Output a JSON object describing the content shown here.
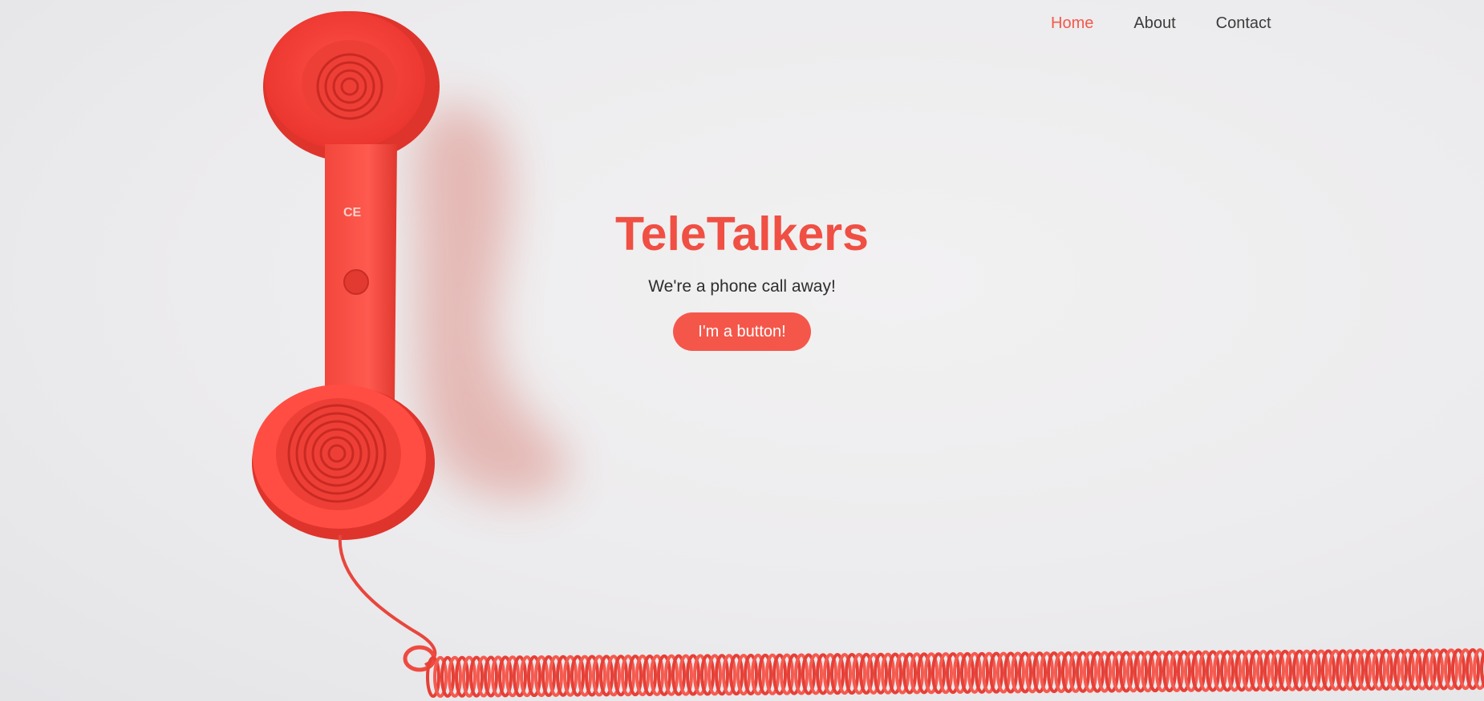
{
  "nav": {
    "items": [
      {
        "label": "Home",
        "active": true
      },
      {
        "label": "About",
        "active": false
      },
      {
        "label": "Contact",
        "active": false
      }
    ],
    "active_color": "#f25a4a",
    "text_color": "#3c3c3c"
  },
  "hero": {
    "title": "TeleTalkers",
    "subtitle": "We're a phone call away!",
    "button_label": "I'm a button!",
    "accent_color": "#f04f43",
    "image_icon": "red-telephone-handset-image"
  }
}
